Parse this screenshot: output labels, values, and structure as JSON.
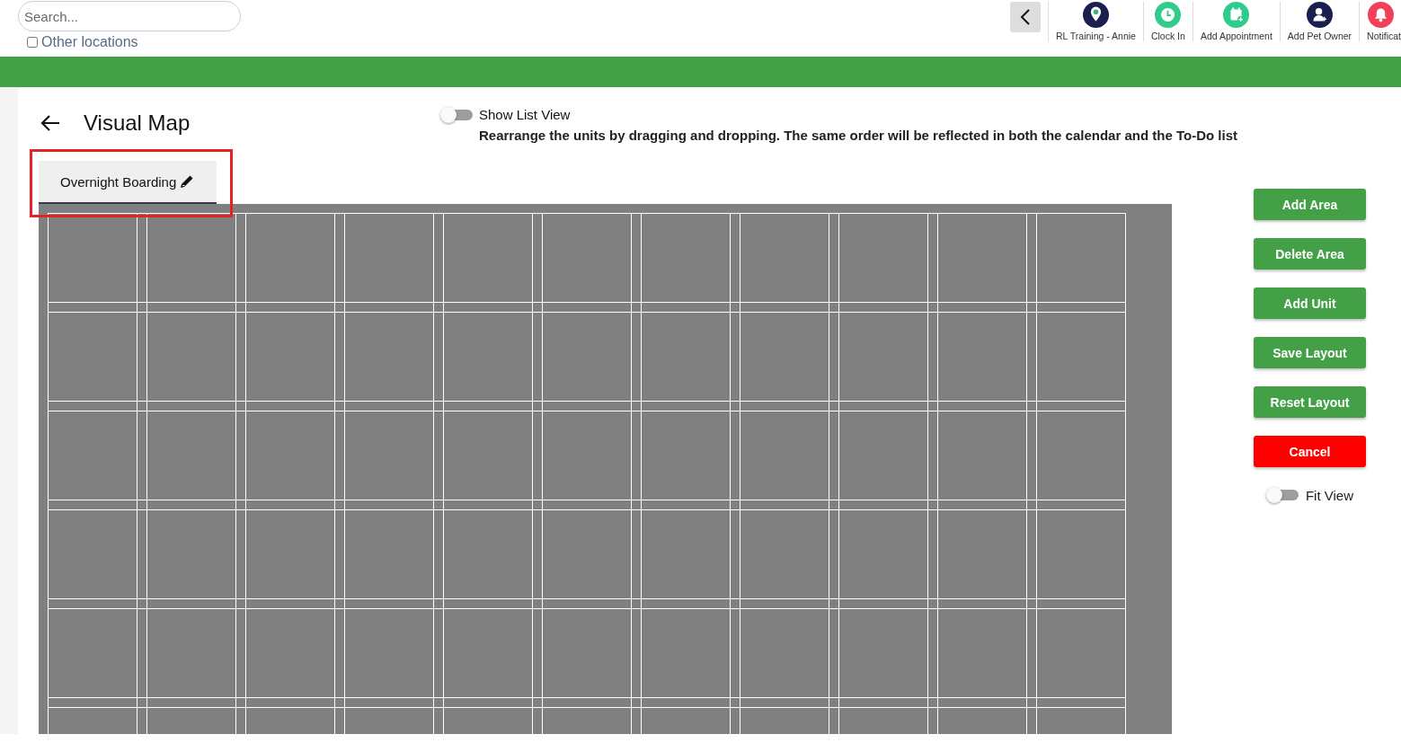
{
  "search": {
    "placeholder": "Search..."
  },
  "other_locations": {
    "label": "Other locations",
    "checked": false
  },
  "nav": [
    {
      "kind": "location",
      "label": "RL Training - Annie"
    },
    {
      "kind": "clock",
      "label": "Clock In"
    },
    {
      "kind": "appointment",
      "label": "Add Appointment"
    },
    {
      "kind": "owner",
      "label": "Add Pet Owner"
    },
    {
      "kind": "bell",
      "label": "Notificat"
    }
  ],
  "page": {
    "title": "Visual Map",
    "list_view": {
      "label": "Show List View",
      "on": false
    },
    "hint": "Rearrange the units by dragging and dropping. The same order will be reflected in both the calendar and the To-Do list"
  },
  "tabs": [
    {
      "label": "Overnight Boarding",
      "selected": true
    }
  ],
  "buttons": [
    {
      "label": "Add Area",
      "kind": "primary"
    },
    {
      "label": "Delete Area",
      "kind": "primary"
    },
    {
      "label": "Add Unit",
      "kind": "primary"
    },
    {
      "label": "Save Layout",
      "kind": "primary"
    },
    {
      "label": "Reset Layout",
      "kind": "primary"
    },
    {
      "label": "Cancel",
      "kind": "danger"
    }
  ],
  "fit_view": {
    "label": "Fit View",
    "on": false
  }
}
